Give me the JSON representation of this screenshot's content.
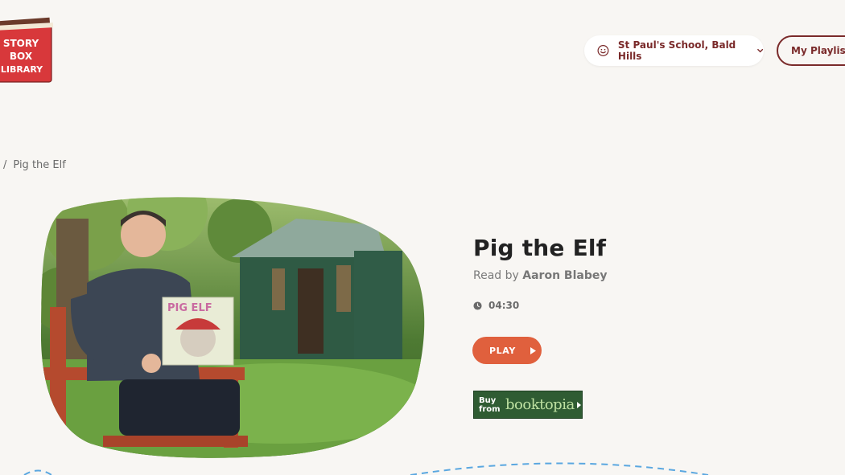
{
  "logo": {
    "text_lines": [
      "STORY",
      "BOX",
      "LIBRARY"
    ],
    "color": "#d8383b"
  },
  "header": {
    "school_label": "St Paul's School, Bald Hills",
    "playlists_label": "My Playlists"
  },
  "breadcrumb": {
    "separator": "/",
    "current": "Pig the Elf"
  },
  "book": {
    "title": "Pig the Elf",
    "read_by_prefix": "Read by",
    "reader": "Aaron Blabey",
    "duration": "04:30",
    "cover_text": "PIG ELF"
  },
  "actions": {
    "play_label": "PLAY",
    "buy_label_line1": "Buy",
    "buy_label_line2": "from",
    "booktopia_label": "booktopia"
  },
  "colors": {
    "accent": "#e0603d",
    "brand_dark_red": "#7a2a2a",
    "booktopia_green": "#2f5c33",
    "background": "#f8f6f3",
    "dash_blue": "#5aa7e0"
  }
}
